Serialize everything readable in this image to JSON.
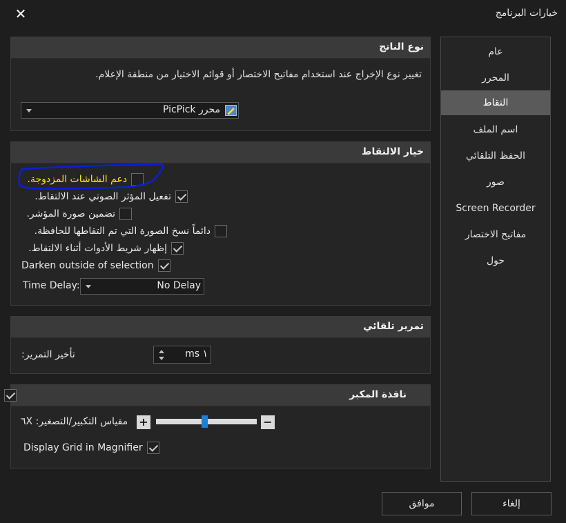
{
  "window": {
    "title": "خيارات البرنامج"
  },
  "sidebar": {
    "items": [
      {
        "label": "عام"
      },
      {
        "label": "المحرر"
      },
      {
        "label": "التقاط",
        "active": true
      },
      {
        "label": "اسم الملف"
      },
      {
        "label": "الحفظ التلقائي"
      },
      {
        "label": "صور"
      },
      {
        "label": "Screen Recorder"
      },
      {
        "label": "مفاتيح الاختصار"
      },
      {
        "label": "حول"
      }
    ]
  },
  "output_type": {
    "title": "نوع الناتج",
    "description": "تغيير نوع الإخراج عند استخدام مفاتيح الاختصار أو قوائم الاختيار من منطقة الإعلام.",
    "selected": "محرر PicPick"
  },
  "capture_options": {
    "title": "خيار الالتقاط",
    "items": [
      {
        "label": "دعم الشاشات المزدوجة.",
        "checked": false,
        "highlight": true
      },
      {
        "label": "تفعيل المؤثر الصوتي عند الالتقاط.",
        "checked": true
      },
      {
        "label": "تضمين صورة المؤشر.",
        "checked": false
      },
      {
        "label": "دائماً نسخ الصورة التي تم التقاطها للحافظة.",
        "checked": false
      },
      {
        "label": "إظهار شريط الأدوات أثناء الالتقاط.",
        "checked": true
      },
      {
        "label": "Darken outside of selection",
        "checked": true
      }
    ],
    "time_delay": {
      "label": "Time Delay:",
      "value": "No Delay"
    }
  },
  "auto_scroll": {
    "title": "تمرير تلقائي",
    "delay_label": "تأخير التمرير:",
    "delay_value": "ms ١"
  },
  "magnifier": {
    "title": "نافذة المكبر",
    "enabled": true,
    "zoom_label": "مقياس التكبير/التصغير: ٦X",
    "zoom_level": 0.48,
    "plus_label": "+",
    "minus_label": "−",
    "display_grid": {
      "label": "Display Grid in Magnifier",
      "checked": true
    }
  },
  "footer": {
    "ok_label": "موافق",
    "cancel_label": "إلغاء"
  },
  "colors": {
    "highlight_text": "#ffee00",
    "annotation_stroke": "#0a1fd8",
    "slider_thumb": "#1e7fd6",
    "active_nav": "#5a5a5a"
  }
}
